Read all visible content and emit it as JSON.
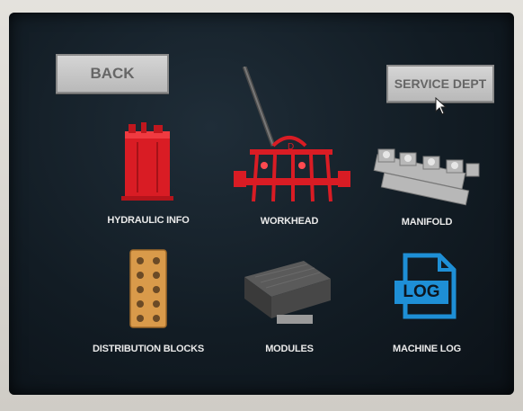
{
  "header": {
    "back_label": "BACK",
    "service_label": "SERVICE DEPT"
  },
  "tiles": [
    {
      "label": "HYDRAULIC INFO",
      "icon": "hydraulic-tank-icon"
    },
    {
      "label": "WORKHEAD",
      "icon": "workhead-icon"
    },
    {
      "label": "MANIFOLD",
      "icon": "manifold-icon"
    },
    {
      "label": "DISTRIBUTION BLOCKS",
      "icon": "distribution-block-icon"
    },
    {
      "label": "MODULES",
      "icon": "module-icon"
    },
    {
      "label": "MACHINE LOG",
      "icon": "log-file-icon",
      "badge": "LOG"
    }
  ],
  "colors": {
    "accent_red": "#e0202a",
    "log_blue": "#1e8fd6",
    "block_orange": "#d99a4a"
  }
}
